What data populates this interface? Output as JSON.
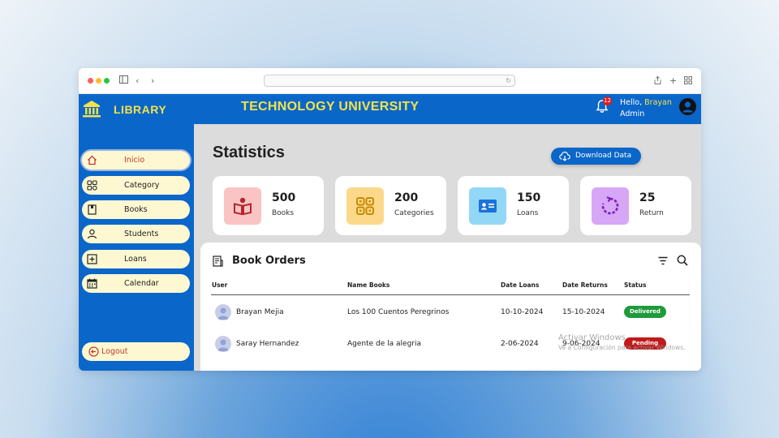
{
  "app": {
    "name": "LIBRARY",
    "university": "TECHNOLOGY UNIVERSITY",
    "brand_color": "#0a66c9",
    "accent_color": "#f3e34a"
  },
  "header": {
    "notification_count": "12",
    "greeting_prefix": "Hello,",
    "user_name": "Brayan",
    "user_role": "Admin"
  },
  "sidebar": {
    "items": [
      {
        "label": "Inicio",
        "icon": "home-icon",
        "active": true
      },
      {
        "label": "Category",
        "icon": "grid-icon"
      },
      {
        "label": "Books",
        "icon": "book-icon"
      },
      {
        "label": "Students",
        "icon": "user-icon"
      },
      {
        "label": "Loans",
        "icon": "add-square-icon"
      },
      {
        "label": "Calendar",
        "icon": "calendar-icon"
      }
    ],
    "logout_label": "Logout"
  },
  "main": {
    "title": "Statistics",
    "download_label": "Download Data"
  },
  "stats": [
    {
      "value": "500",
      "label": "Books",
      "icon": "book-reader-icon",
      "bg": "#fbc4c4",
      "color": "#b3262b"
    },
    {
      "value": "200",
      "label": "Categories",
      "icon": "categories-icon",
      "bg": "#fcd98a",
      "color": "#c98a05"
    },
    {
      "value": "150",
      "label": "Loans",
      "icon": "id-card-icon",
      "bg": "#93d7f7",
      "color": "#1d72d8"
    },
    {
      "value": "25",
      "label": "Return",
      "icon": "rotate-icon",
      "bg": "#d8a6f7",
      "color": "#7b1fb8"
    }
  ],
  "orders": {
    "title": "Book Orders",
    "columns": [
      "User",
      "Name Books",
      "Date Loans",
      "Date Returns",
      "Status"
    ],
    "rows": [
      {
        "user": "Brayan Mejia",
        "book": "Los 100 Cuentos Peregrinos",
        "date_loan": "10-10-2024",
        "date_return": "15-10-2024",
        "status": "Delivered",
        "status_color": "#1e9b3a"
      },
      {
        "user": "Saray Hernandez",
        "book": "Agente de la alegria",
        "date_loan": "2-06-2024",
        "date_return": "9-06-2024",
        "status": "Pending",
        "status_color": "#c01a1a"
      }
    ]
  },
  "watermark": {
    "line1": "Activar Windows",
    "line2": "Ve a Configuración para activar Windows."
  }
}
